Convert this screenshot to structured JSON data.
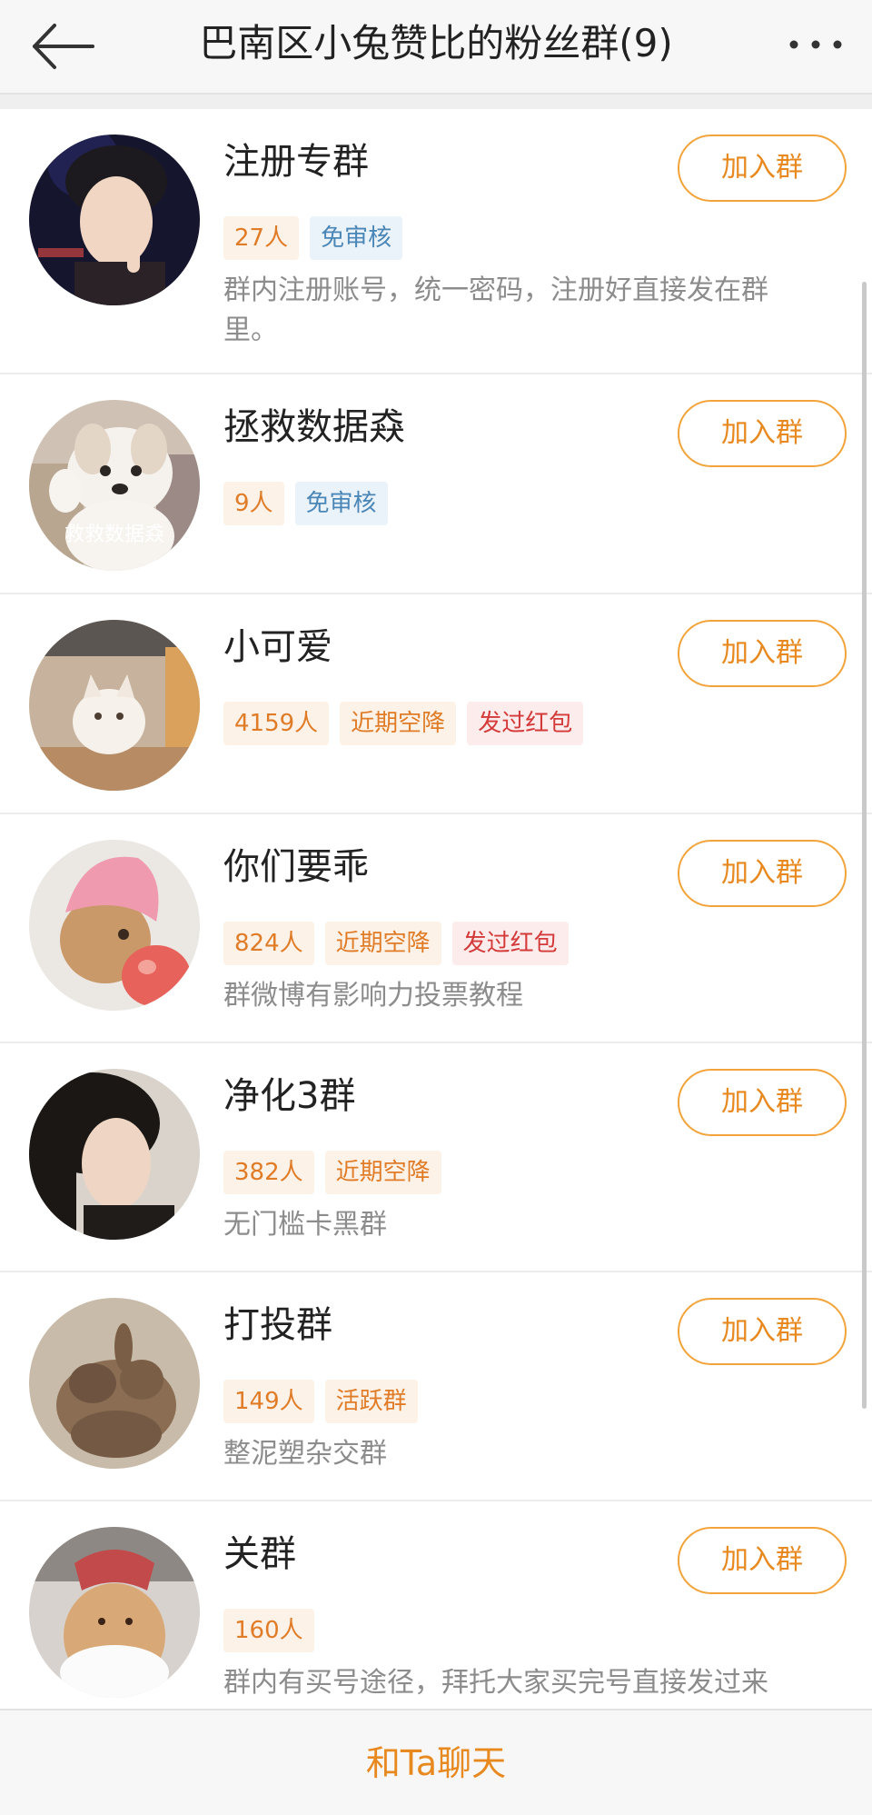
{
  "header": {
    "title": "巴南区小兔赞比的粉丝群(9)"
  },
  "groups": [
    {
      "name": "注册专群",
      "badges": [
        "27人",
        "免审核"
      ],
      "desc": "群内注册账号，统一密码，注册好直接发在群\n里。",
      "join_label": "加入群",
      "avatar_caption": ""
    },
    {
      "name": "拯救数据猋",
      "badges": [
        "9人",
        "免审核"
      ],
      "desc": "",
      "join_label": "加入群",
      "avatar_caption": "救救数据猋"
    },
    {
      "name": "小可爱",
      "badges": [
        "4159人",
        "近期空降",
        "发过红包"
      ],
      "desc": "",
      "join_label": "加入群",
      "avatar_caption": ""
    },
    {
      "name": "你们要乖",
      "badges": [
        "824人",
        "近期空降",
        "发过红包"
      ],
      "desc": "群微博有影响力投票教程",
      "join_label": "加入群",
      "avatar_caption": ""
    },
    {
      "name": "净化3群",
      "badges": [
        "382人",
        "近期空降"
      ],
      "desc": "无门槛卡黑群",
      "join_label": "加入群",
      "avatar_caption": ""
    },
    {
      "name": "打投群",
      "badges": [
        "149人",
        "活跃群"
      ],
      "desc": "整泥塑杂交群",
      "join_label": "加入群",
      "avatar_caption": ""
    },
    {
      "name": "关群",
      "badges": [
        "160人"
      ],
      "desc": "群内有买号途径，拜托大家买完号直接发过来",
      "join_label": "加入群",
      "avatar_caption": ""
    }
  ],
  "bottom": {
    "chat_label": "和Ta聊天"
  },
  "icons": {
    "back": "arrow-left-icon",
    "more": "more-dots-icon"
  },
  "colors": {
    "accent": "#e8891f",
    "count_badge_bg": "#fdf2e7",
    "approve_badge_text": "#4a86b6",
    "redpacket_badge_text": "#d43a3a"
  }
}
